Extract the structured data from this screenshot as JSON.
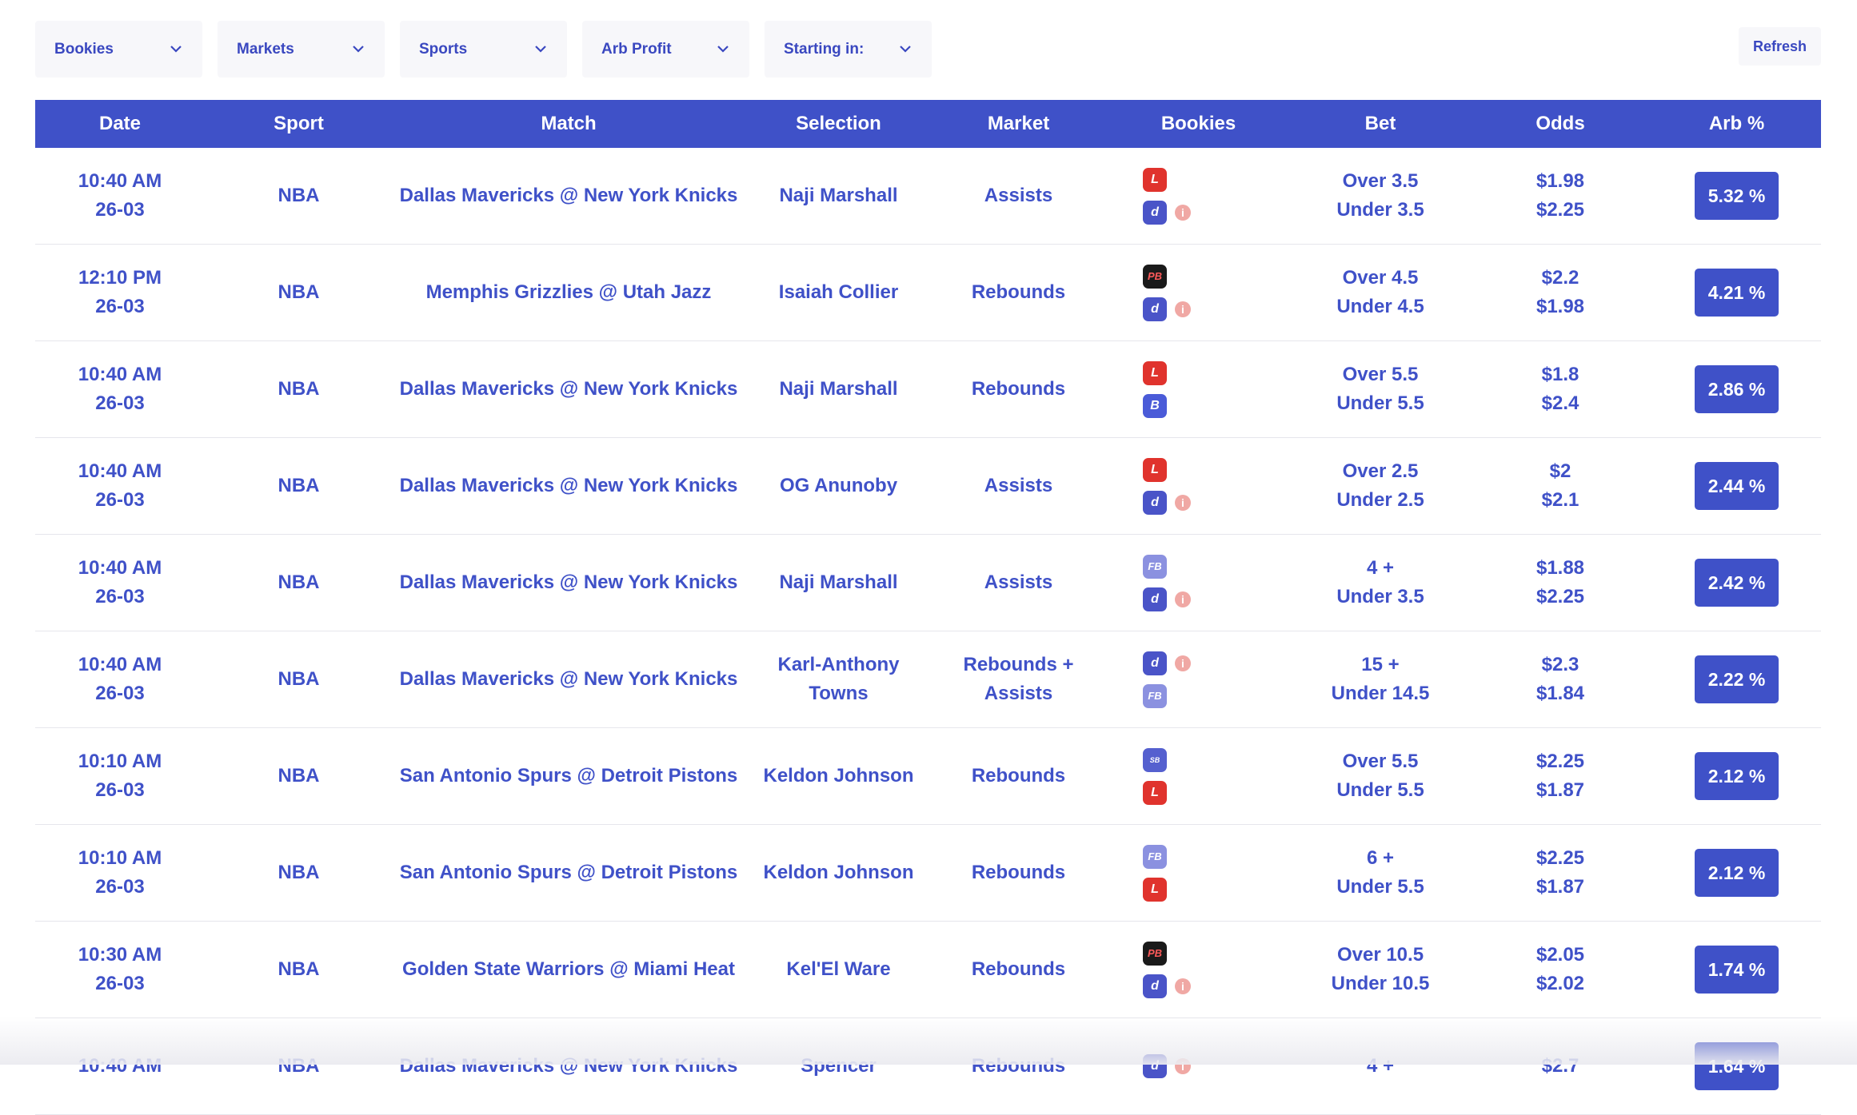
{
  "filters": [
    {
      "label": "Bookies"
    },
    {
      "label": "Markets"
    },
    {
      "label": "Sports"
    },
    {
      "label": "Arb Profit"
    },
    {
      "label": "Starting in:"
    }
  ],
  "refresh_label": "Refresh",
  "columns": [
    "Date",
    "Sport",
    "Match",
    "Selection",
    "Market",
    "Bookies",
    "Bet",
    "Odds",
    "Arb %"
  ],
  "colors": {
    "accent": "#3f51c8",
    "info": "#f0a8a4"
  },
  "rows": [
    {
      "time": "10:40 AM",
      "date": "26-03",
      "sport": "NBA",
      "match": "Dallas Mavericks @ New York Knicks",
      "selection": [
        "Naji Marshall"
      ],
      "market": [
        "Assists"
      ],
      "bookies": [
        {
          "icon": "ladbrokes-logo-icon",
          "text": "L",
          "cls": "lg-red",
          "info": false
        },
        {
          "icon": "dabble-logo-icon",
          "text": "d",
          "cls": "lg-blue",
          "info": true
        }
      ],
      "bet": [
        "Over 3.5",
        "Under 3.5"
      ],
      "odds": [
        "$1.98",
        "$2.25"
      ],
      "arb": "5.32 %"
    },
    {
      "time": "12:10 PM",
      "date": "26-03",
      "sport": "NBA",
      "match": "Memphis Grizzlies @ Utah Jazz",
      "selection": [
        "Isaiah Collier"
      ],
      "market": [
        "Rebounds"
      ],
      "bookies": [
        {
          "icon": "pointsbet-logo-icon",
          "text": "PB",
          "cls": "lg-dark",
          "info": false
        },
        {
          "icon": "dabble-logo-icon",
          "text": "d",
          "cls": "lg-blue",
          "info": true
        }
      ],
      "bet": [
        "Over 4.5",
        "Under 4.5"
      ],
      "odds": [
        "$2.2",
        "$1.98"
      ],
      "arb": "4.21 %"
    },
    {
      "time": "10:40 AM",
      "date": "26-03",
      "sport": "NBA",
      "match": "Dallas Mavericks @ New York Knicks",
      "selection": [
        "Naji Marshall"
      ],
      "market": [
        "Rebounds"
      ],
      "bookies": [
        {
          "icon": "ladbrokes-logo-icon",
          "text": "L",
          "cls": "lg-red",
          "info": false
        },
        {
          "icon": "betr-logo-icon",
          "text": "B",
          "cls": "lg-b",
          "info": false
        }
      ],
      "bet": [
        "Over 5.5",
        "Under 5.5"
      ],
      "odds": [
        "$1.8",
        "$2.4"
      ],
      "arb": "2.86 %"
    },
    {
      "time": "10:40 AM",
      "date": "26-03",
      "sport": "NBA",
      "match": "Dallas Mavericks @ New York Knicks",
      "selection": [
        "OG Anunoby"
      ],
      "market": [
        "Assists"
      ],
      "bookies": [
        {
          "icon": "ladbrokes-logo-icon",
          "text": "L",
          "cls": "lg-red",
          "info": false
        },
        {
          "icon": "dabble-logo-icon",
          "text": "d",
          "cls": "lg-blue",
          "info": true
        }
      ],
      "bet": [
        "Over 2.5",
        "Under 2.5"
      ],
      "odds": [
        "$2",
        "$2.1"
      ],
      "arb": "2.44 %"
    },
    {
      "time": "10:40 AM",
      "date": "26-03",
      "sport": "NBA",
      "match": "Dallas Mavericks @ New York Knicks",
      "selection": [
        "Naji Marshall"
      ],
      "market": [
        "Assists"
      ],
      "bookies": [
        {
          "icon": "fb-logo-icon",
          "text": "FB",
          "cls": "lg-lav",
          "info": false
        },
        {
          "icon": "dabble-logo-icon",
          "text": "d",
          "cls": "lg-blue",
          "info": true
        }
      ],
      "bet": [
        "4 +",
        "Under 3.5"
      ],
      "odds": [
        "$1.88",
        "$2.25"
      ],
      "arb": "2.42 %"
    },
    {
      "time": "10:40 AM",
      "date": "26-03",
      "sport": "NBA",
      "match": "Dallas Mavericks @ New York Knicks",
      "selection": [
        "Karl-Anthony",
        "Towns"
      ],
      "market": [
        "Rebounds +",
        "Assists"
      ],
      "bookies": [
        {
          "icon": "dabble-logo-icon",
          "text": "d",
          "cls": "lg-blue",
          "info": true
        },
        {
          "icon": "fb-logo-icon",
          "text": "FB",
          "cls": "lg-lav",
          "info": false
        }
      ],
      "bet": [
        "15 +",
        "Under 14.5"
      ],
      "odds": [
        "$2.3",
        "$1.84"
      ],
      "arb": "2.22 %"
    },
    {
      "time": "10:10 AM",
      "date": "26-03",
      "sport": "NBA",
      "match": "San Antonio Spurs @ Detroit Pistons",
      "selection": [
        "Keldon Johnson"
      ],
      "market": [
        "Rebounds"
      ],
      "bookies": [
        {
          "icon": "sportsbet-logo-icon",
          "text": "SB",
          "cls": "lg-sb",
          "info": false
        },
        {
          "icon": "ladbrokes-logo-icon",
          "text": "L",
          "cls": "lg-red",
          "info": false
        }
      ],
      "bet": [
        "Over 5.5",
        "Under 5.5"
      ],
      "odds": [
        "$2.25",
        "$1.87"
      ],
      "arb": "2.12 %"
    },
    {
      "time": "10:10 AM",
      "date": "26-03",
      "sport": "NBA",
      "match": "San Antonio Spurs @ Detroit Pistons",
      "selection": [
        "Keldon Johnson"
      ],
      "market": [
        "Rebounds"
      ],
      "bookies": [
        {
          "icon": "fb-logo-icon",
          "text": "FB",
          "cls": "lg-lav",
          "info": false
        },
        {
          "icon": "ladbrokes-logo-icon",
          "text": "L",
          "cls": "lg-red",
          "info": false
        }
      ],
      "bet": [
        "6 +",
        "Under 5.5"
      ],
      "odds": [
        "$2.25",
        "$1.87"
      ],
      "arb": "2.12 %"
    },
    {
      "time": "10:30 AM",
      "date": "26-03",
      "sport": "NBA",
      "match": "Golden State Warriors @ Miami Heat",
      "selection": [
        "Kel'El Ware"
      ],
      "market": [
        "Rebounds"
      ],
      "bookies": [
        {
          "icon": "pointsbet-logo-icon",
          "text": "PB",
          "cls": "lg-dark",
          "info": false
        },
        {
          "icon": "dabble-logo-icon",
          "text": "d",
          "cls": "lg-blue",
          "info": true
        }
      ],
      "bet": [
        "Over 10.5",
        "Under 10.5"
      ],
      "odds": [
        "$2.05",
        "$2.02"
      ],
      "arb": "1.74 %"
    },
    {
      "time": "10:40 AM",
      "date": "",
      "sport": "NBA",
      "match": "Dallas Mavericks @ New York Knicks",
      "selection": [
        "Spencer"
      ],
      "market": [
        "Rebounds"
      ],
      "bookies": [
        {
          "icon": "dabble-logo-icon",
          "text": "d",
          "cls": "lg-blue",
          "info": true
        }
      ],
      "bet": [
        "4 +"
      ],
      "odds": [
        "$2.7"
      ],
      "arb": "1.64 %"
    }
  ]
}
